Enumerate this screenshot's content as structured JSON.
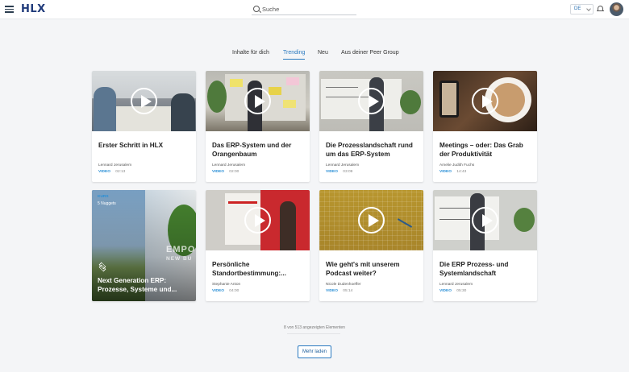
{
  "header": {
    "logo": "HLX",
    "search": {
      "placeholder": "Suche",
      "value": ""
    },
    "language": "DE",
    "icons": {
      "menu": "menu-icon",
      "search": "search-icon",
      "notifications": "bell-icon"
    }
  },
  "tabs": [
    {
      "label": "Inhalte für dich",
      "active": false
    },
    {
      "label": "Trending",
      "active": true
    },
    {
      "label": "Neu",
      "active": false
    },
    {
      "label": "Aus deiner Peer Group",
      "active": false
    }
  ],
  "cards": [
    {
      "title": "Erster Schritt in HLX",
      "author": "Lennard Jerusalem",
      "type": "VIDEO",
      "duration": "02:13"
    },
    {
      "title": "Das ERP-System und der Orangenbaum",
      "author": "Lennard Jerusalem",
      "type": "VIDEO",
      "duration": "02:00"
    },
    {
      "title": "Die Prozesslandschaft rund um das ERP-System",
      "author": "Lennard Jerusalem",
      "type": "VIDEO",
      "duration": "03:09"
    },
    {
      "title": "Meetings – oder: Das Grab der Produktivität",
      "author": "Amelie Judith Fuchs",
      "type": "VIDEO",
      "duration": "14:43"
    },
    {
      "title": "Persönliche Standortbestimmung:...",
      "author": "Stephanie Anton",
      "type": "VIDEO",
      "duration": "04:00"
    },
    {
      "title": "Wie geht's mit unserem Podcast weiter?",
      "author": "Nicole Dudenhoeffer",
      "type": "VIDEO",
      "duration": "05:14"
    },
    {
      "title": "Die ERP Prozess- und Systemlandschaft",
      "author": "Lennard Jerusalem",
      "type": "VIDEO",
      "duration": "05:30"
    }
  ],
  "nugget": {
    "type": "KURS",
    "count": "5 Nuggets",
    "bg_text": "EMPO",
    "bg_sub": "NEW BU",
    "title": "Next Generation ERP: Prozesse, Systeme und..."
  },
  "footer": {
    "count_text": "8 von 513 angezeigten Elementen",
    "more_label": "Mehr laden"
  }
}
